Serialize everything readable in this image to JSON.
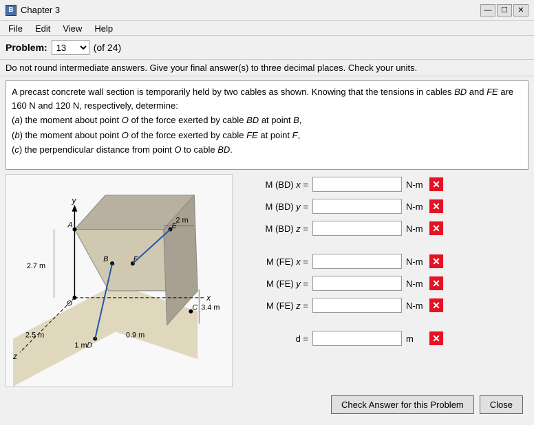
{
  "titleBar": {
    "icon": "B",
    "title": "Chapter 3",
    "minimizeLabel": "—",
    "maximizeLabel": "☐",
    "closeLabel": "✕"
  },
  "menuBar": {
    "items": [
      "File",
      "Edit",
      "View",
      "Help"
    ]
  },
  "problemBar": {
    "label": "Problem:",
    "selectedProblem": "13",
    "total": "(of 24)"
  },
  "instructions": "Do not round intermediate answers.  Give your final answer(s) to three decimal places.  Check your units.",
  "problemText": {
    "intro": "A precast concrete wall section is temporarily held by two cables as shown. Knowing that the tensions in cables BD and FE are 160 N and 120 N, respectively, determine:",
    "parts": [
      "(a)  the moment about point O of the force exerted by cable BD at point B,",
      "(b)  the moment about point O of the force exerted by cable FE at point F,",
      "(c)  the perpendicular distance from point O to cable BD."
    ]
  },
  "form": {
    "rows": [
      {
        "label": "M (BD) x =",
        "unit": "N-m",
        "id": "mbd-x"
      },
      {
        "label": "M (BD) y =",
        "unit": "N-m",
        "id": "mbd-y"
      },
      {
        "label": "M (BD) z =",
        "unit": "N-m",
        "id": "mbd-z"
      },
      {
        "label": "M (FE) x =",
        "unit": "N-m",
        "id": "mfe-x"
      },
      {
        "label": "M (FE) y =",
        "unit": "N-m",
        "id": "mfe-y"
      },
      {
        "label": "M (FE) z =",
        "unit": "N-m",
        "id": "mfe-z"
      },
      {
        "label": "d =",
        "unit": "m",
        "id": "d"
      }
    ],
    "checkButton": "Check Answer for this Problem",
    "closeButton": "Close"
  },
  "diagram": {
    "dimensions": {
      "top": "2 m",
      "left": "2.7 m",
      "bottom_left": "2.5 m",
      "bottom_mid": "1 m",
      "bottom_right": "0.9 m",
      "right": "3.4 m"
    },
    "points": [
      "y",
      "A",
      "B",
      "E",
      "F",
      "O",
      "C",
      "D",
      "x",
      "z"
    ]
  }
}
